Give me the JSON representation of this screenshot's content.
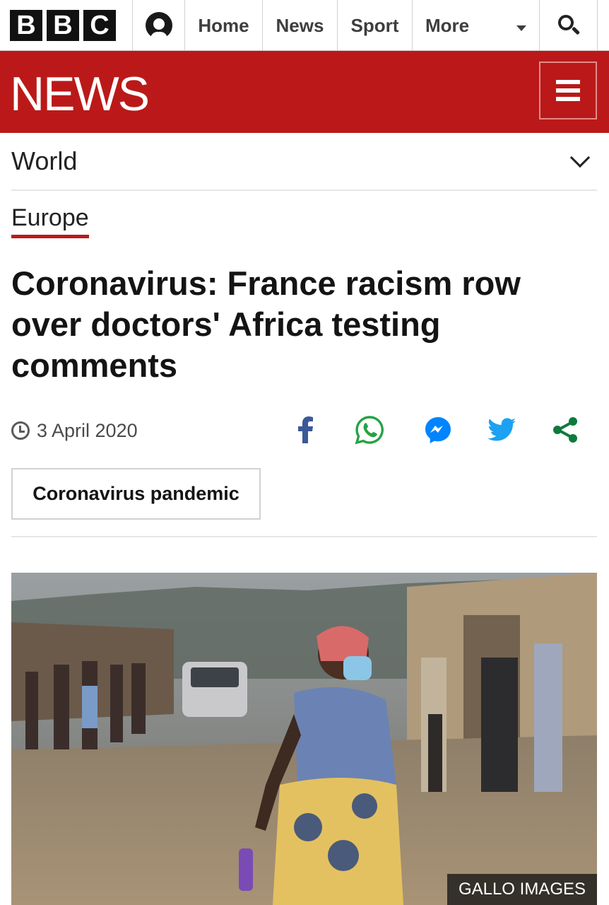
{
  "topnav": {
    "logo_letters": [
      "B",
      "B",
      "C"
    ],
    "links": [
      "Home",
      "News",
      "Sport",
      "More"
    ]
  },
  "masthead": {
    "title": "NEWS"
  },
  "section": {
    "title": "World",
    "subsection": "Europe"
  },
  "article": {
    "headline": "Coronavirus: France racism row over doctors' Africa testing comments",
    "date": "3 April 2020",
    "tag": "Coronavirus pandemic",
    "image_credit": "GALLO IMAGES"
  },
  "share_icons": [
    "facebook-icon",
    "whatsapp-icon",
    "messenger-icon",
    "twitter-icon",
    "share-icon"
  ],
  "colors": {
    "brand_red": "#bb1919",
    "facebook": "#3b5998",
    "whatsapp": "#25a244",
    "messenger": "#0084ff",
    "twitter": "#1da1f2",
    "share": "#0e7a3d"
  }
}
